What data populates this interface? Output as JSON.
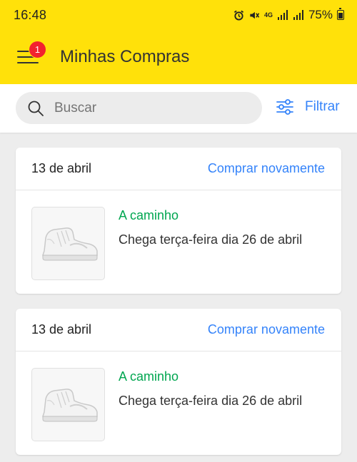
{
  "status_bar": {
    "time": "16:48",
    "network": "4G",
    "battery": "75%"
  },
  "header": {
    "title": "Minhas Compras",
    "notification_count": "1",
    "background": "#ffe10a"
  },
  "search": {
    "placeholder": "Buscar",
    "filter_label": "Filtrar"
  },
  "orders": [
    {
      "date": "13 de abril",
      "buy_again_label": "Comprar novamente",
      "status": "A caminho",
      "arrival": "Chega terça-feira dia 26 de abril",
      "image_icon": "sneaker-icon"
    },
    {
      "date": "13 de abril",
      "buy_again_label": "Comprar novamente",
      "status": "A caminho",
      "arrival": "Chega terça-feira dia 26 de abril",
      "image_icon": "sneaker-icon"
    }
  ],
  "colors": {
    "accent_blue": "#3483fa",
    "status_green": "#00a650",
    "badge_red": "#f2222e"
  }
}
